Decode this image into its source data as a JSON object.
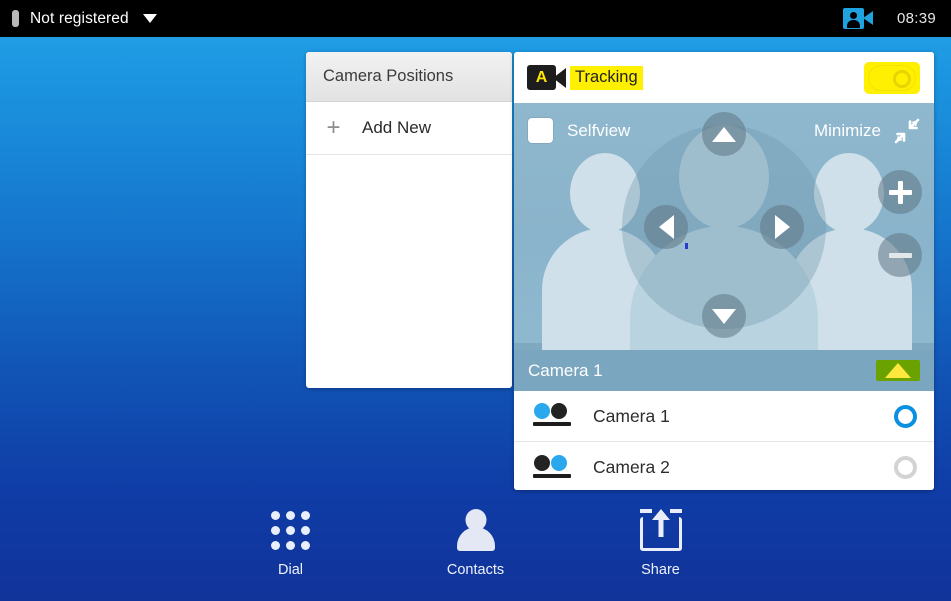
{
  "statusbar": {
    "registration_status": "Not registered",
    "dropdown_icon": "chevron-down-icon",
    "camera_icon": "person-video-camera-icon",
    "clock": "08:39"
  },
  "camera_positions_panel": {
    "title": "Camera Positions",
    "items": [
      {
        "icon": "plus-icon",
        "label": "Add New"
      }
    ]
  },
  "camera_panel": {
    "tracking": {
      "icon": "camera-a-icon",
      "icon_letter": "A",
      "label": "Tracking",
      "label_highlight_color": "#ffef00",
      "toggle_state": "on",
      "toggle_highlight_color": "#ffef00"
    },
    "selfview": {
      "checkbox_label": "Selfview",
      "checkbox_state": "unchecked",
      "minimize_label": "Minimize",
      "minimize_icon": "minimize-arrows-icon"
    },
    "controls": {
      "up": "arrow-up-icon",
      "down": "arrow-down-icon",
      "left": "arrow-left-icon",
      "right": "arrow-right-icon",
      "zoom_in": "plus-icon",
      "zoom_out": "minus-icon"
    },
    "active_camera_bar": {
      "label": "Camera 1",
      "expand_icon": "caret-up-icon",
      "expand_highlight_color": "#6aa300",
      "caret_color": "#ffe83d"
    },
    "camera_list": [
      {
        "icon": "camera-dots-icon",
        "label": "Camera 1",
        "selected": true
      },
      {
        "icon": "camera-dots-icon",
        "label": "Camera 2",
        "selected": false
      }
    ]
  },
  "bottom_toolbar": {
    "items": [
      {
        "icon": "dialpad-icon",
        "label": "Dial"
      },
      {
        "icon": "contacts-person-icon",
        "label": "Contacts"
      },
      {
        "icon": "share-upload-icon",
        "label": "Share"
      }
    ]
  },
  "theme": {
    "background_top": "#22a4e9",
    "background_bottom": "#11339a",
    "accent_blue": "#0b8fe0",
    "highlight_yellow": "#ffef00",
    "highlight_green": "#6aa300"
  }
}
